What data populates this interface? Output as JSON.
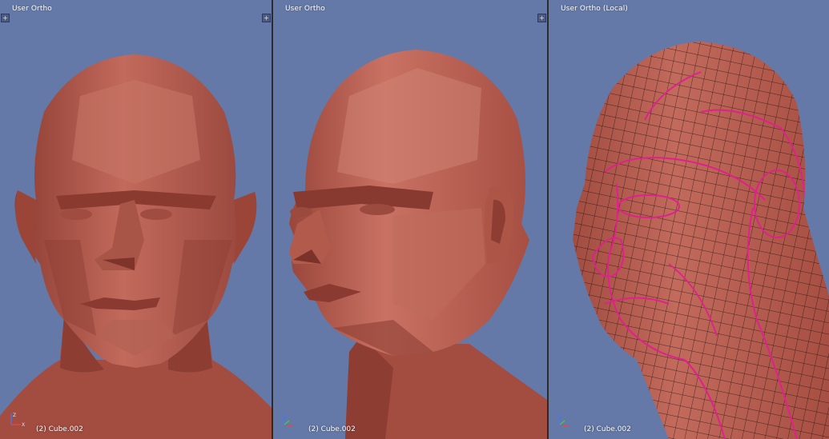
{
  "viewports": [
    {
      "title": "User Ortho",
      "object_label": "(2) Cube.002"
    },
    {
      "title": "User Ortho",
      "object_label": "(2) Cube.002"
    },
    {
      "title": "User Ortho (Local)",
      "object_label": "(2) Cube.002"
    }
  ],
  "colors": {
    "viewport_bg": "#6479a8",
    "skin": "#b5574a",
    "skin_light": "#c97264",
    "skin_dark": "#8e3d33",
    "wire": "#1f1210",
    "seam": "#e0208e",
    "axis_x": "#e04848",
    "axis_y": "#48c848",
    "axis_z": "#4878e8"
  },
  "icons": {
    "corner": "plus-icon",
    "axes": "axis-gizmo-icon"
  }
}
